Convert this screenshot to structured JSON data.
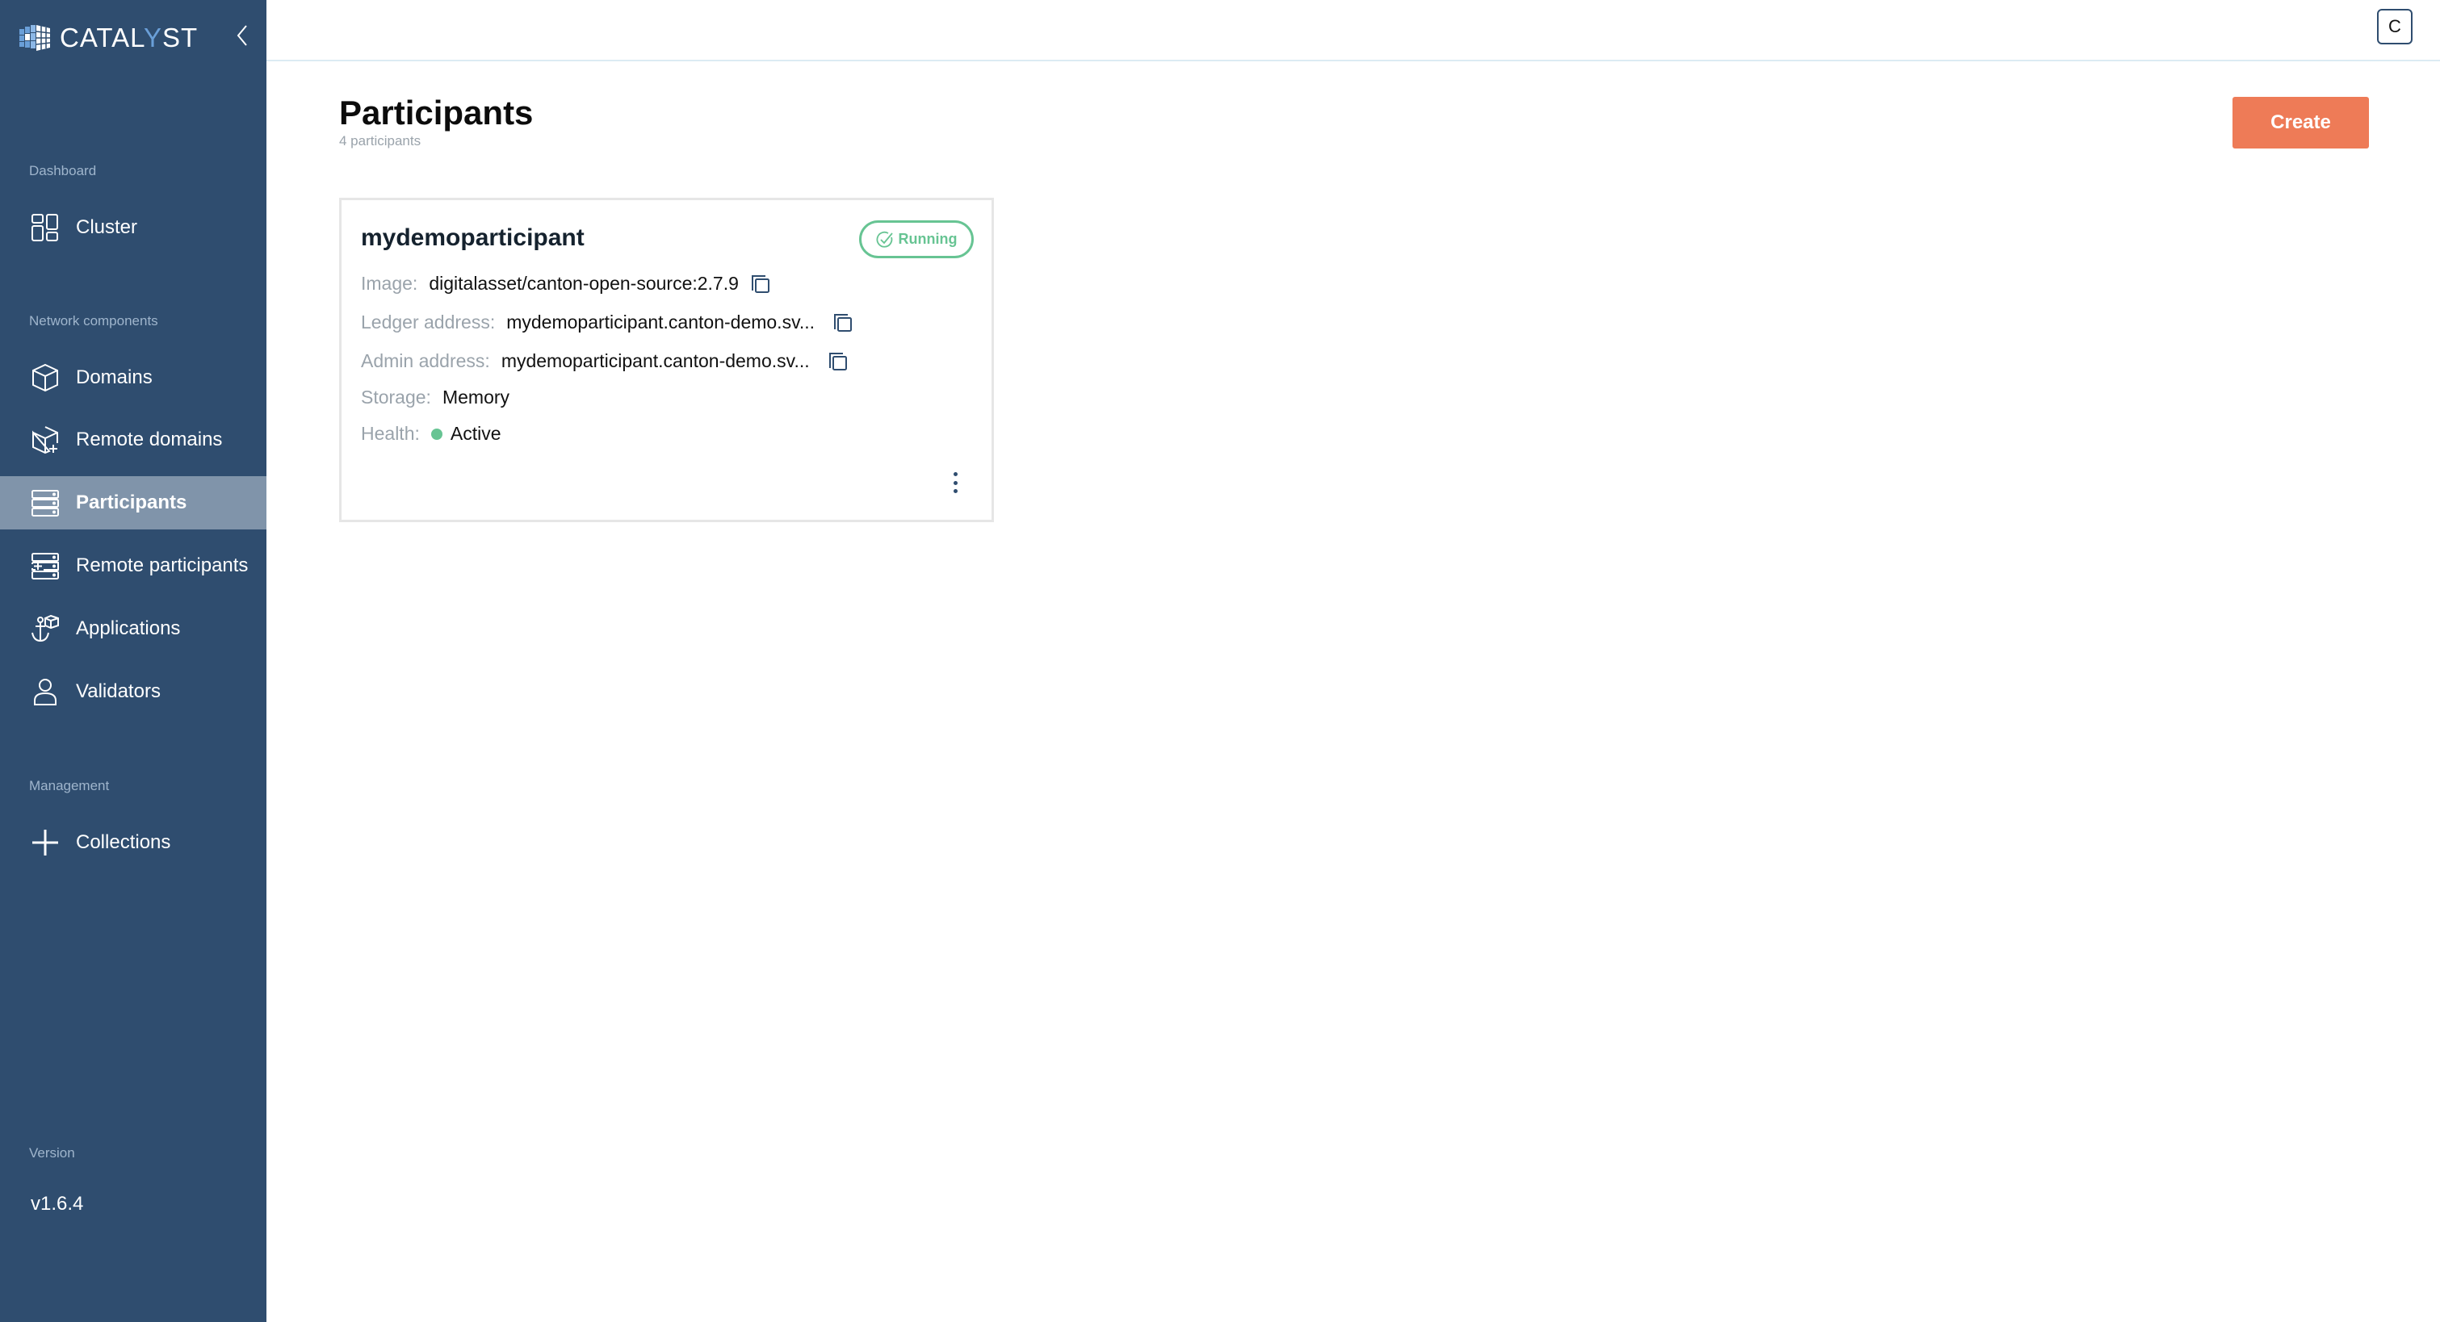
{
  "app": {
    "logo_prefix": "CATAL",
    "logo_accent": "Y",
    "logo_suffix": "ST",
    "brand_color": "#2f4d6f",
    "accent_color": "#ee7b57",
    "status_color": "#67c493"
  },
  "sidebar": {
    "sections": [
      {
        "label": "Dashboard",
        "items": [
          {
            "label": "Cluster",
            "icon": "grid-icon",
            "active": false
          }
        ]
      },
      {
        "label": "Network components",
        "items": [
          {
            "label": "Domains",
            "icon": "cube-icon",
            "active": false
          },
          {
            "label": "Remote domains",
            "icon": "cube-plus-icon",
            "active": false
          },
          {
            "label": "Participants",
            "icon": "server-icon",
            "active": true
          },
          {
            "label": "Remote participants",
            "icon": "server-plus-icon",
            "active": false
          },
          {
            "label": "Applications",
            "icon": "anchor-cube-icon",
            "active": false
          },
          {
            "label": "Validators",
            "icon": "user-icon",
            "active": false
          }
        ]
      },
      {
        "label": "Management",
        "items": [
          {
            "label": "Collections",
            "icon": "plus-icon",
            "active": false
          }
        ]
      }
    ],
    "version_label": "Version",
    "version_value": "v1.6.4"
  },
  "header": {
    "avatar_initial": "C"
  },
  "main": {
    "title": "Participants",
    "subtitle": "4 participants",
    "create_label": "Create",
    "cards": [
      {
        "name": "mydemoparticipant",
        "status": "Running",
        "fields": {
          "image_label": "Image:",
          "image_value": "digitalasset/canton-open-source:2.7.9",
          "ledger_label": "Ledger address:",
          "ledger_value": "mydemoparticipant.canton-demo.sv...",
          "admin_label": "Admin address:",
          "admin_value": "mydemoparticipant.canton-demo.sv...",
          "storage_label": "Storage:",
          "storage_value": "Memory",
          "health_label": "Health:",
          "health_value": "Active"
        }
      }
    ]
  }
}
